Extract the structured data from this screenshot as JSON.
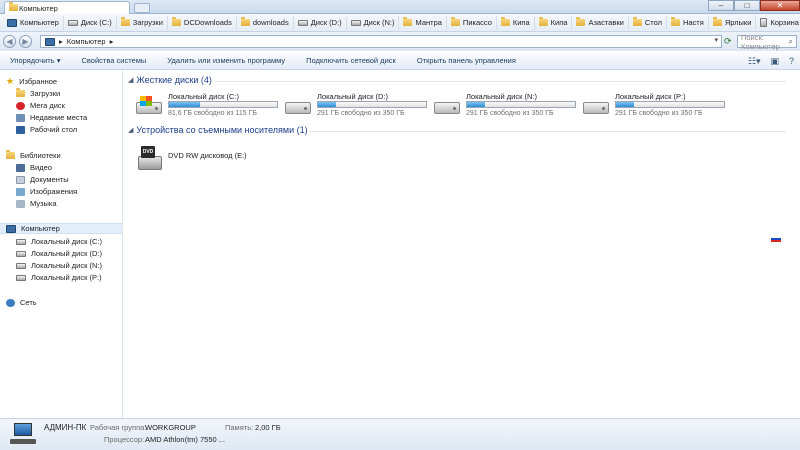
{
  "tab": {
    "title": "Компьютер"
  },
  "window_buttons": {
    "minimize": "–",
    "maximize": "□",
    "close": "✕"
  },
  "favorites": [
    {
      "label": "Компьютер",
      "icon": "computer-icon"
    },
    {
      "label": "Диск (C:)",
      "icon": "drive-icon"
    },
    {
      "label": "Загрузки",
      "icon": "folder-icon"
    },
    {
      "label": "DCDownloads",
      "icon": "folder-icon"
    },
    {
      "label": "downloads",
      "icon": "folder-icon"
    },
    {
      "label": "Диск (D:)",
      "icon": "drive-icon"
    },
    {
      "label": "Диск (N:)",
      "icon": "drive-icon"
    },
    {
      "label": "Мантра",
      "icon": "folder-icon"
    },
    {
      "label": "Пикассо",
      "icon": "folder-icon"
    },
    {
      "label": "Кипа",
      "icon": "folder-icon"
    },
    {
      "label": "Кипа",
      "icon": "folder-icon"
    },
    {
      "label": "Азаставки",
      "icon": "folder-icon"
    },
    {
      "label": "Стол",
      "icon": "folder-icon"
    },
    {
      "label": "Настя",
      "icon": "folder-icon"
    },
    {
      "label": "Ярлыки",
      "icon": "folder-icon"
    },
    {
      "label": "Корзина",
      "icon": "recycle-bin-icon"
    }
  ],
  "address": {
    "path": "Компьютер",
    "separator": "▸"
  },
  "search": {
    "placeholder": "Поиск: Компьютер"
  },
  "toolbar": {
    "organize": "Упорядочить ▾",
    "system_properties": "Свойства системы",
    "uninstall": "Удалить или изменить программу",
    "map_drive": "Подключить сетевой диск",
    "control_panel": "Открыть панель управления"
  },
  "sidebar": {
    "favorites": {
      "title": "Избранное",
      "items": [
        "Загрузки",
        "Мега диск",
        "Недавние места",
        "Рабочий стол"
      ]
    },
    "libraries": {
      "title": "Библиотеки",
      "items": [
        "Видео",
        "Документы",
        "Изображения",
        "Музыка"
      ]
    },
    "computer": {
      "title": "Компьютер",
      "items": [
        "Локальный диск (C:)",
        "Локальный диск (D:)",
        "Локальный диск (N:)",
        "Локальный диск (P:)"
      ]
    },
    "network": {
      "title": "Сеть"
    }
  },
  "groups": {
    "hard_disks": {
      "title": "Жесткие диски (4)",
      "drives": [
        {
          "name": "Локальный диск (C:)",
          "free": "81,6 ГБ свободно из 115 ГБ",
          "used_fraction": 0.29
        },
        {
          "name": "Локальный диск (D:)",
          "free": "291 ГБ свободно из 350 ГБ",
          "used_fraction": 0.17
        },
        {
          "name": "Локальный диск (N:)",
          "free": "291 ГБ свободно из 350 ГБ",
          "used_fraction": 0.17
        },
        {
          "name": "Локальный диск (P:)",
          "free": "291 ГБ свободно из 350 ГБ",
          "used_fraction": 0.17
        }
      ]
    },
    "removable": {
      "title": "Устройства со съемными носителями (1)",
      "drives": [
        {
          "name": "DVD RW дисковод (E:)",
          "icon_text": "DVD"
        }
      ]
    }
  },
  "details": {
    "pc_name": "АДМИН-ПК",
    "workgroup_label": "Рабочая группа:",
    "workgroup": "WORKGROUP",
    "memory_label": "Память:",
    "memory": "2,00 ГБ",
    "cpu_label": "Процессор:",
    "cpu": "AMD Athlon(tm) 7550 ..."
  }
}
